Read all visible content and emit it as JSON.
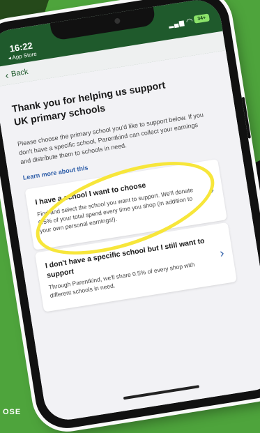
{
  "status_bar": {
    "time": "16:22",
    "back_to": "◂ App Store",
    "battery": "34+"
  },
  "nav": {
    "back_label": "Back"
  },
  "page": {
    "title": "Thank you for helping us support UK primary schools",
    "intro": "Please choose the primary school you'd like to support below. If you don't have a specific school, Parentkind can collect your earnings and distribute them to schools in need.",
    "learn_more": "Learn more about this"
  },
  "options": [
    {
      "title": "I have a school I want to choose",
      "description": "Find and select the school you want to support. We'll donate 0.5% of your total spend every time you shop (in addition to your own personal earnings!)."
    },
    {
      "title": "I don't have a specific school but I still want to support",
      "description": "Through Parentkind, we'll share 0.5% of every shop with different schools in need."
    }
  ],
  "corner_label": "OSE",
  "colors": {
    "background": "#4ea43c",
    "header": "#1f5a2c",
    "link": "#2d5da8",
    "highlight": "#f7e63a"
  }
}
